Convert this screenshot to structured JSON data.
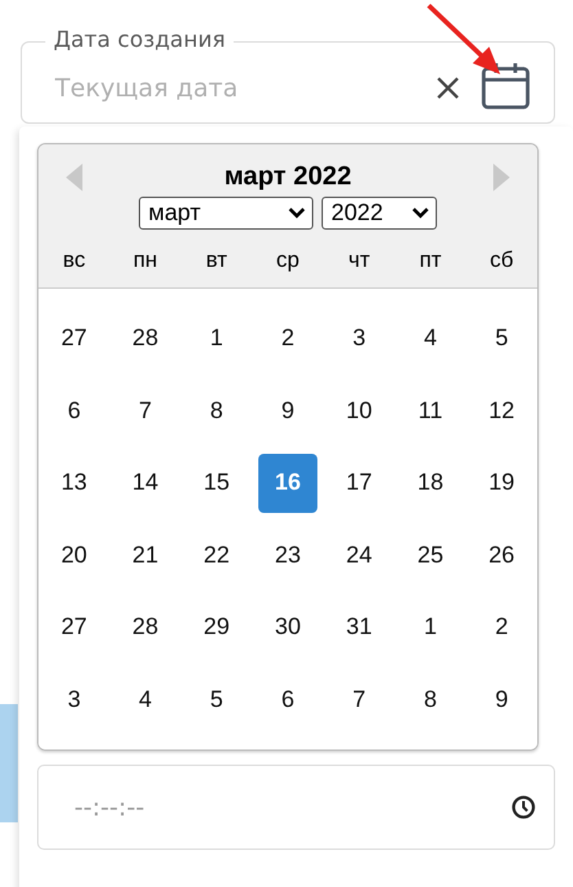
{
  "date_field": {
    "legend": "Дата создания",
    "placeholder": "Текущая дата"
  },
  "calendar": {
    "title": "март 2022",
    "month_select": "март",
    "year_select": "2022",
    "weekdays": [
      "вс",
      "пн",
      "вт",
      "ср",
      "чт",
      "пт",
      "сб"
    ],
    "weeks": [
      [
        {
          "day": "27",
          "selected": false
        },
        {
          "day": "28",
          "selected": false
        },
        {
          "day": "1",
          "selected": false
        },
        {
          "day": "2",
          "selected": false
        },
        {
          "day": "3",
          "selected": false
        },
        {
          "day": "4",
          "selected": false
        },
        {
          "day": "5",
          "selected": false
        }
      ],
      [
        {
          "day": "6",
          "selected": false
        },
        {
          "day": "7",
          "selected": false
        },
        {
          "day": "8",
          "selected": false
        },
        {
          "day": "9",
          "selected": false
        },
        {
          "day": "10",
          "selected": false
        },
        {
          "day": "11",
          "selected": false
        },
        {
          "day": "12",
          "selected": false
        }
      ],
      [
        {
          "day": "13",
          "selected": false
        },
        {
          "day": "14",
          "selected": false
        },
        {
          "day": "15",
          "selected": false
        },
        {
          "day": "16",
          "selected": true
        },
        {
          "day": "17",
          "selected": false
        },
        {
          "day": "18",
          "selected": false
        },
        {
          "day": "19",
          "selected": false
        }
      ],
      [
        {
          "day": "20",
          "selected": false
        },
        {
          "day": "21",
          "selected": false
        },
        {
          "day": "22",
          "selected": false
        },
        {
          "day": "23",
          "selected": false
        },
        {
          "day": "24",
          "selected": false
        },
        {
          "day": "25",
          "selected": false
        },
        {
          "day": "26",
          "selected": false
        }
      ],
      [
        {
          "day": "27",
          "selected": false
        },
        {
          "day": "28",
          "selected": false
        },
        {
          "day": "29",
          "selected": false
        },
        {
          "day": "30",
          "selected": false
        },
        {
          "day": "31",
          "selected": false
        },
        {
          "day": "1",
          "selected": false
        },
        {
          "day": "2",
          "selected": false
        }
      ],
      [
        {
          "day": "3",
          "selected": false
        },
        {
          "day": "4",
          "selected": false
        },
        {
          "day": "5",
          "selected": false
        },
        {
          "day": "6",
          "selected": false
        },
        {
          "day": "7",
          "selected": false
        },
        {
          "day": "8",
          "selected": false
        },
        {
          "day": "9",
          "selected": false
        }
      ]
    ]
  },
  "time_field": {
    "placeholder": "--:--:--"
  }
}
